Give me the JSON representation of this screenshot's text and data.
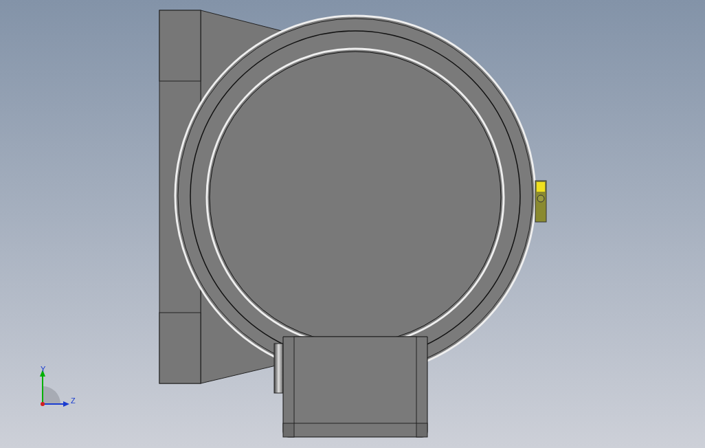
{
  "viewport": {
    "triad": {
      "axes": [
        {
          "kind": "vertical",
          "label": "Y",
          "color": "#00b000"
        },
        {
          "kind": "horizontal",
          "label": "Z",
          "color": "#1a3cd0"
        }
      ]
    }
  }
}
